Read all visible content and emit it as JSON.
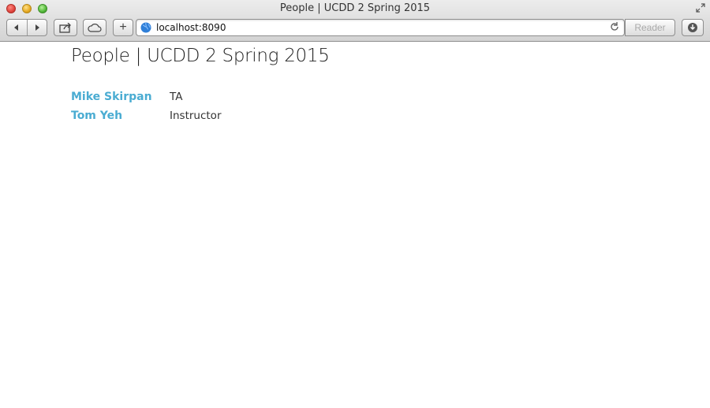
{
  "window": {
    "title": "People | UCDD 2 Spring 2015"
  },
  "toolbar": {
    "back_icon": "back-arrow-icon",
    "forward_icon": "forward-arrow-icon",
    "share_icon": "share-icon",
    "cloud_icon": "icloud-tabs-icon",
    "new_tab_label": "+",
    "url": "localhost:8090",
    "reader_label": "Reader",
    "download_icon": "download-icon"
  },
  "page": {
    "title": "People | UCDD 2 Spring 2015",
    "people": [
      {
        "name": "Mike Skirpan",
        "role": "TA"
      },
      {
        "name": "Tom Yeh",
        "role": "Instructor"
      }
    ]
  },
  "colors": {
    "link": "#4aacd2",
    "text": "#333333"
  }
}
